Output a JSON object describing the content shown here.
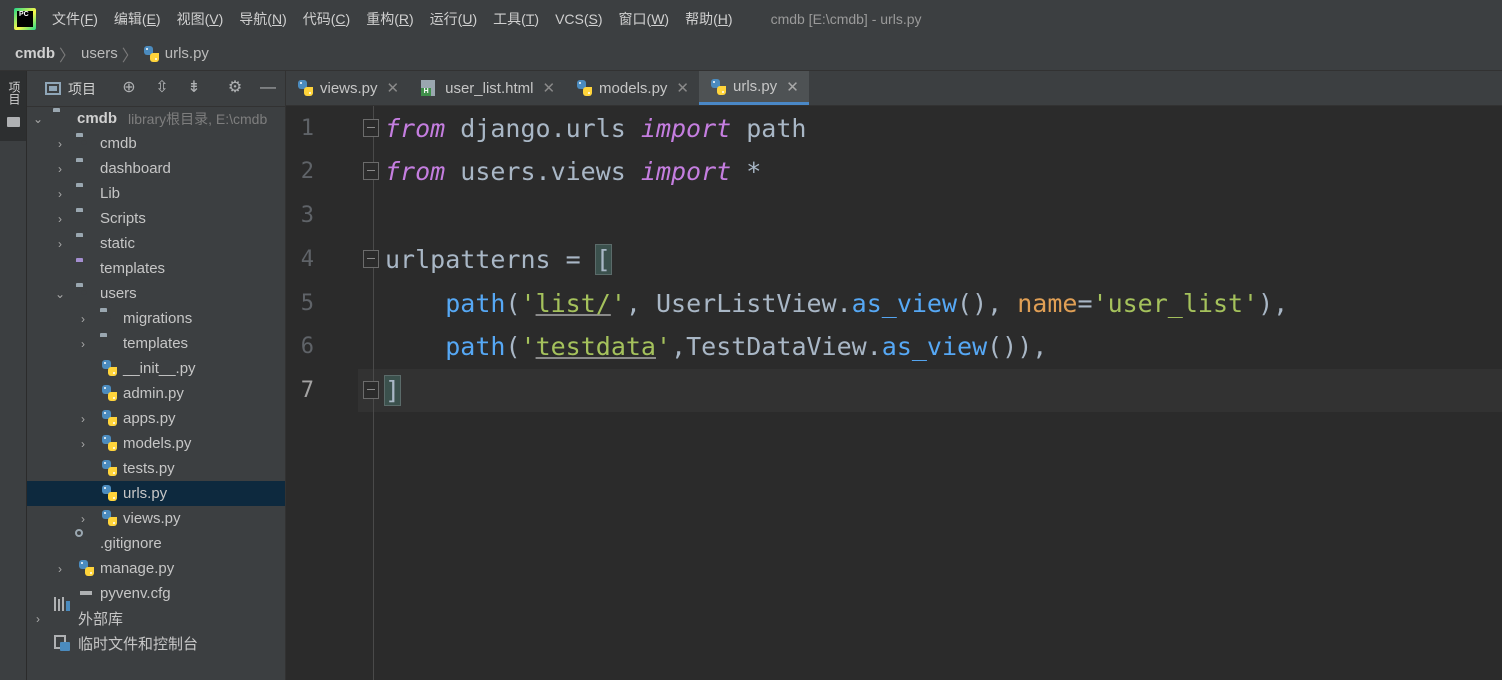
{
  "menubar": {
    "logo_text": "PC",
    "items": [
      {
        "label": "文件(",
        "key": "F",
        "suffix": ")"
      },
      {
        "label": "编辑(",
        "key": "E",
        "suffix": ")"
      },
      {
        "label": "视图(",
        "key": "V",
        "suffix": ")"
      },
      {
        "label": "导航(",
        "key": "N",
        "suffix": ")"
      },
      {
        "label": "代码(",
        "key": "C",
        "suffix": ")"
      },
      {
        "label": "重构(",
        "key": "R",
        "suffix": ")"
      },
      {
        "label": "运行(",
        "key": "U",
        "suffix": ")"
      },
      {
        "label": "工具(",
        "key": "T",
        "suffix": ")"
      },
      {
        "label": "VCS(",
        "key": "S",
        "suffix": ")"
      },
      {
        "label": "窗口(",
        "key": "W",
        "suffix": ")"
      },
      {
        "label": "帮助(",
        "key": "H",
        "suffix": ")"
      }
    ],
    "window_title": "cmdb [E:\\cmdb] - urls.py"
  },
  "breadcrumb": {
    "items": [
      "cmdb",
      "users",
      "urls.py"
    ]
  },
  "toolstrip": {
    "project_tab": "项目"
  },
  "project_panel": {
    "title": "项目",
    "root": {
      "name": "cmdb",
      "hint": "library根目录, E:\\cmdb"
    },
    "items": [
      {
        "name": "cmdb"
      },
      {
        "name": "dashboard"
      },
      {
        "name": "Lib"
      },
      {
        "name": "Scripts"
      },
      {
        "name": "static"
      },
      {
        "name": "templates"
      },
      {
        "name": "users"
      },
      {
        "name": "migrations"
      },
      {
        "name": "templates"
      },
      {
        "name": "__init__.py"
      },
      {
        "name": "admin.py"
      },
      {
        "name": "apps.py"
      },
      {
        "name": "models.py"
      },
      {
        "name": "tests.py"
      },
      {
        "name": "urls.py"
      },
      {
        "name": "views.py"
      },
      {
        "name": ".gitignore"
      },
      {
        "name": "manage.py"
      },
      {
        "name": "pyvenv.cfg"
      },
      {
        "name": "外部库"
      },
      {
        "name": "临时文件和控制台"
      }
    ]
  },
  "tabs": [
    {
      "label": "views.py",
      "icon": "python-file-icon"
    },
    {
      "label": "user_list.html",
      "icon": "html-file-icon"
    },
    {
      "label": "models.py",
      "icon": "python-file-icon"
    },
    {
      "label": "urls.py",
      "icon": "python-file-icon",
      "active": true
    }
  ],
  "editor": {
    "line_numbers": [
      "1",
      "2",
      "3",
      "4",
      "5",
      "6",
      "7"
    ],
    "current_line": 7,
    "line1": {
      "kw1": "from",
      "t1": " django.urls ",
      "kw2": "import",
      "t2": " path"
    },
    "line2": {
      "kw1": "from",
      "t1": " users.views ",
      "kw2": "import",
      "t2": " *"
    },
    "line4": {
      "t1": "urlpatterns = ",
      "br": "["
    },
    "line5": {
      "indent": "    ",
      "fn": "path",
      "p1": "(",
      "q1": "'",
      "s1": "list/",
      "q2": "'",
      "t1": ", UserListView.",
      "fn2": "as_view",
      "t2": "(), ",
      "param": "name",
      "eq": "=",
      "s2": "'user_list'",
      "t3": "),"
    },
    "line6": {
      "indent": "    ",
      "fn": "path",
      "p1": "(",
      "q1": "'",
      "s1": "testdata",
      "q2": "'",
      "t1": ",TestDataView.",
      "fn2": "as_view",
      "t2": "()),"
    },
    "line7": {
      "br": "]"
    }
  },
  "colors": {
    "accent": "#4a88c7",
    "keyword": "#c57ee0",
    "function": "#56a8f5",
    "string": "#a5c25c",
    "selection": "#0d293e"
  }
}
